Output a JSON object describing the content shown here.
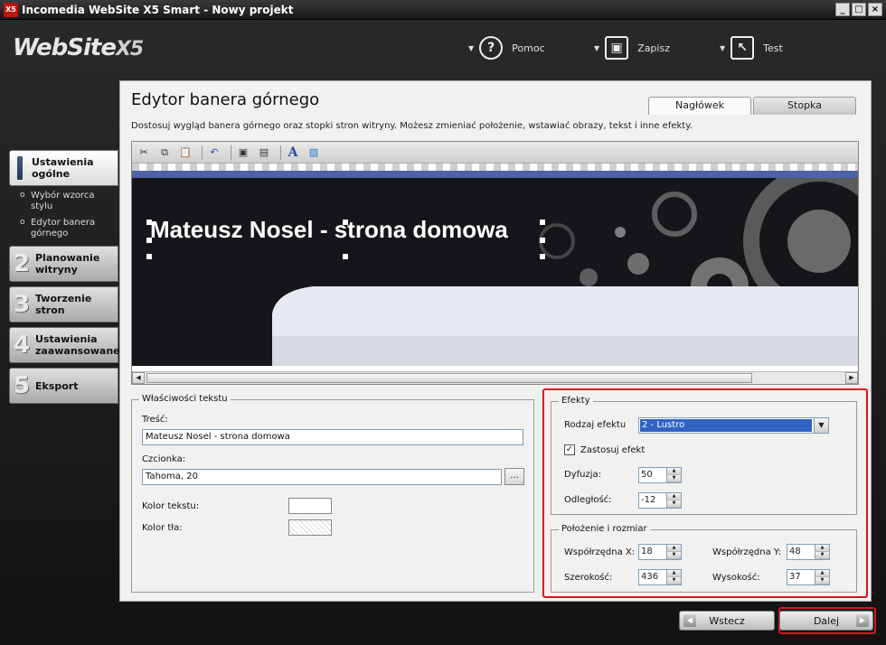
{
  "window": {
    "title": "Incomedia WebSite X5 Smart - Nowy projekt",
    "app_icon": "X5",
    "controls": [
      "_",
      "□",
      "×"
    ]
  },
  "header": {
    "logo_text": "WebSite",
    "logo_suffix": "X5",
    "tools": [
      {
        "label": "Pomoc",
        "icon": "help-icon",
        "glyph": "?"
      },
      {
        "label": "Zapisz",
        "icon": "save-icon",
        "glyph": "▣"
      },
      {
        "label": "Test",
        "icon": "test-icon",
        "glyph": "↖"
      }
    ]
  },
  "sidebar": {
    "items": [
      {
        "num": "",
        "label": "Ustawienia ogólne",
        "active": true
      },
      {
        "num": "2",
        "label": "Planowanie witryny"
      },
      {
        "num": "3",
        "label": "Tworzenie stron"
      },
      {
        "num": "4",
        "label": "Ustawienia zaawansowane"
      },
      {
        "num": "5",
        "label": "Eksport"
      }
    ],
    "subitems": [
      "Wybór wzorca stylu",
      "Edytor banera górnego"
    ]
  },
  "page": {
    "title": "Edytor banera górnego",
    "description": "Dostosuj wygląd banera górnego oraz stopki stron witryny. Możesz zmieniać położenie, wstawiać obrazy, tekst i inne efekty.",
    "tabs": [
      "Nagłówek",
      "Stopka"
    ],
    "active_tab": "Nagłówek"
  },
  "editor": {
    "toolbar_icons": [
      "cut-icon",
      "copy-icon",
      "paste-icon",
      "undo-icon",
      "bring-front-icon",
      "send-back-icon",
      "text-icon",
      "image-icon"
    ],
    "banner_text": "Mateusz Nosel - strona domowa"
  },
  "text_props": {
    "group_title": "Właściwości tekstu",
    "content_label": "Treść:",
    "content_value": "Mateusz Nosel - strona domowa",
    "font_label": "Czcionka:",
    "font_value": "Tahoma, 20",
    "font_button": "...",
    "text_color_label": "Kolor tekstu:",
    "bg_color_label": "Kolor tła:"
  },
  "effects": {
    "group_title": "Efekty",
    "type_label": "Rodzaj efektu",
    "type_value": "2 - Lustro",
    "apply_label": "Zastosuj efekt",
    "apply_checked": true,
    "diffusion_label": "Dyfuzja:",
    "diffusion_value": "50",
    "distance_label": "Odległość:",
    "distance_value": "-12"
  },
  "position": {
    "group_title": "Położenie i rozmiar",
    "x_label": "Współrzędna X:",
    "x_value": "18",
    "y_label": "Współrzędna Y:",
    "y_value": "48",
    "w_label": "Szerokość:",
    "w_value": "436",
    "h_label": "Wysokość:",
    "h_value": "37"
  },
  "footer": {
    "back_label": "Wstecz",
    "next_label": "Dalej"
  },
  "colors": {
    "highlight": "#e0101f",
    "banner_bg": "#15151a",
    "banner_stripe": "#4e63a6",
    "selection": "#3163c5"
  }
}
